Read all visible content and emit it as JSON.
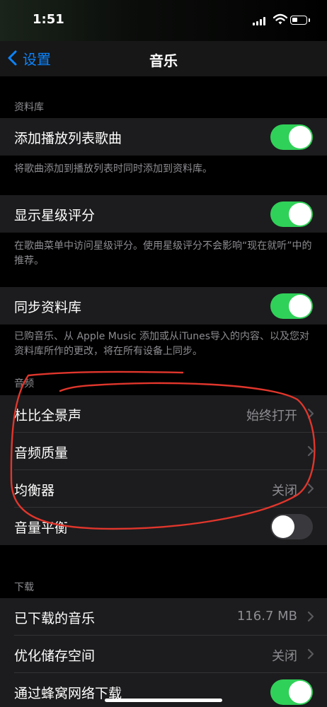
{
  "status": {
    "time": "1:51"
  },
  "nav": {
    "back_label": "设置",
    "title": "音乐"
  },
  "library": {
    "header": "资料库",
    "add_playlist": {
      "label": "添加播放列表歌曲",
      "on": true,
      "footer": "将歌曲添加到播放列表时同时添加到资料库。"
    },
    "show_rating": {
      "label": "显示星级评分",
      "on": true,
      "footer": "在歌曲菜单中访问星级评分。使用星级评分不会影响“现在就听”中的推荐。"
    },
    "sync_library": {
      "label": "同步资料库",
      "on": true,
      "footer": "已购音乐、从 Apple Music 添加或从iTunes导入的内容、以及您对资料库所作的更改，将在所有设备上同步。"
    }
  },
  "audio": {
    "header": "音频",
    "dolby": {
      "label": "杜比全景声",
      "value": "始终打开"
    },
    "quality": {
      "label": "音频质量"
    },
    "eq": {
      "label": "均衡器",
      "value": "关闭"
    },
    "sound_check": {
      "label": "音量平衡",
      "on": false
    }
  },
  "downloads": {
    "header": "下载",
    "downloaded": {
      "label": "已下载的音乐",
      "value": "116.7 MB"
    },
    "optimize": {
      "label": "优化储存空间",
      "value": "关闭"
    },
    "cellular": {
      "label": "通过蜂窝网络下载",
      "on": true
    }
  },
  "colors": {
    "accent": "#0a84ff",
    "toggle_on": "#30d158",
    "annotation": "#e0362c"
  }
}
